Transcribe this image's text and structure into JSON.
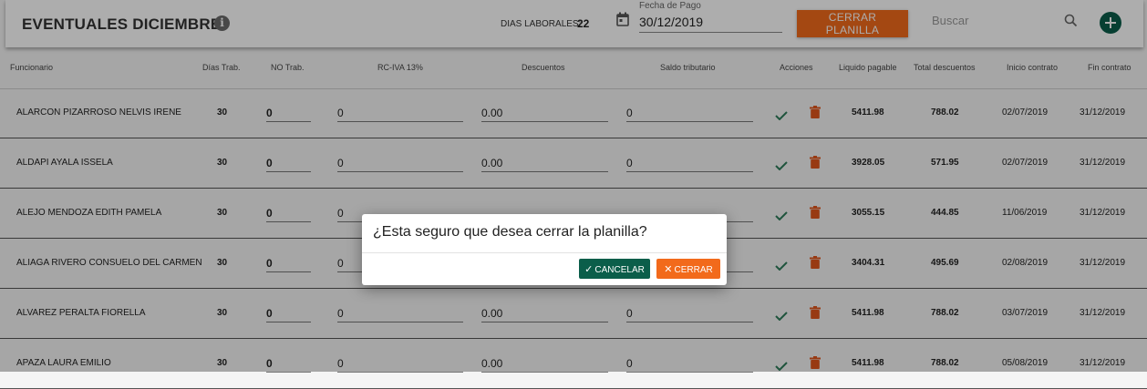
{
  "header": {
    "title": "EVENTUALES DICIEMBRE",
    "info_icon": "i",
    "dias_laborales_label": "DIAS LABORALES:",
    "dias_laborales_value": "22",
    "fecha_caption": "Fecha de Pago",
    "fecha_value": "30/12/2019",
    "cerrar_planilla_label": "CERRAR PLANILLA",
    "search_placeholder": "Buscar",
    "icons": [
      "info-icon",
      "calendar-icon",
      "search-icon",
      "add-icon"
    ]
  },
  "colors": {
    "primary": "#0b5e4a",
    "accent": "#f26a1b",
    "delete": "#e0561c",
    "check": "#2e7d5b"
  },
  "table": {
    "columns": [
      "Funcionario",
      "Días Trab.",
      "NO Trab.",
      "RC-IVA 13%",
      "Descuentos",
      "Saldo tributario",
      "Acciones",
      "Liquido pagable",
      "Total descuentos",
      "Inicio contrato",
      "Fin contrato"
    ],
    "rows": [
      {
        "funcionario": "ALARCON PIZARROSO NELVIS IRENE",
        "dias": "30",
        "no_trab": "0",
        "rc_iva": "0",
        "descuentos": "0.00",
        "saldo": "0",
        "liquido": "5411.98",
        "total_desc": "788.02",
        "inicio": "02/07/2019",
        "fin": "31/12/2019"
      },
      {
        "funcionario": "ALDAPI AYALA ISSELA",
        "dias": "30",
        "no_trab": "0",
        "rc_iva": "0",
        "descuentos": "0.00",
        "saldo": "0",
        "liquido": "3928.05",
        "total_desc": "571.95",
        "inicio": "02/07/2019",
        "fin": "31/12/2019"
      },
      {
        "funcionario": "ALEJO MENDOZA EDITH PAMELA",
        "dias": "30",
        "no_trab": "0",
        "rc_iva": "0",
        "descuentos": "",
        "saldo": "",
        "liquido": "3055.15",
        "total_desc": "444.85",
        "inicio": "11/06/2019",
        "fin": "31/12/2019"
      },
      {
        "funcionario": "ALIAGA RIVERO CONSUELO DEL CARMEN",
        "dias": "30",
        "no_trab": "0",
        "rc_iva": "0",
        "descuentos": "",
        "saldo": "",
        "liquido": "3404.31",
        "total_desc": "495.69",
        "inicio": "02/08/2019",
        "fin": "31/12/2019"
      },
      {
        "funcionario": "ALVAREZ PERALTA FIORELLA",
        "dias": "30",
        "no_trab": "0",
        "rc_iva": "0",
        "descuentos": "0.00",
        "saldo": "0",
        "liquido": "5411.98",
        "total_desc": "788.02",
        "inicio": "03/07/2019",
        "fin": "31/12/2019"
      },
      {
        "funcionario": "APAZA LAURA EMILIO",
        "dias": "30",
        "no_trab": "0",
        "rc_iva": "0",
        "descuentos": "0.00",
        "saldo": "0",
        "liquido": "5411.98",
        "total_desc": "788.02",
        "inicio": "05/08/2019",
        "fin": "31/12/2019"
      }
    ]
  },
  "dialog": {
    "message": "¿Esta seguro que desea cerrar la planilla?",
    "cancel_label": "CANCELAR",
    "cancel_icon": "✓",
    "confirm_label": "CERRAR",
    "confirm_icon": "✕"
  }
}
